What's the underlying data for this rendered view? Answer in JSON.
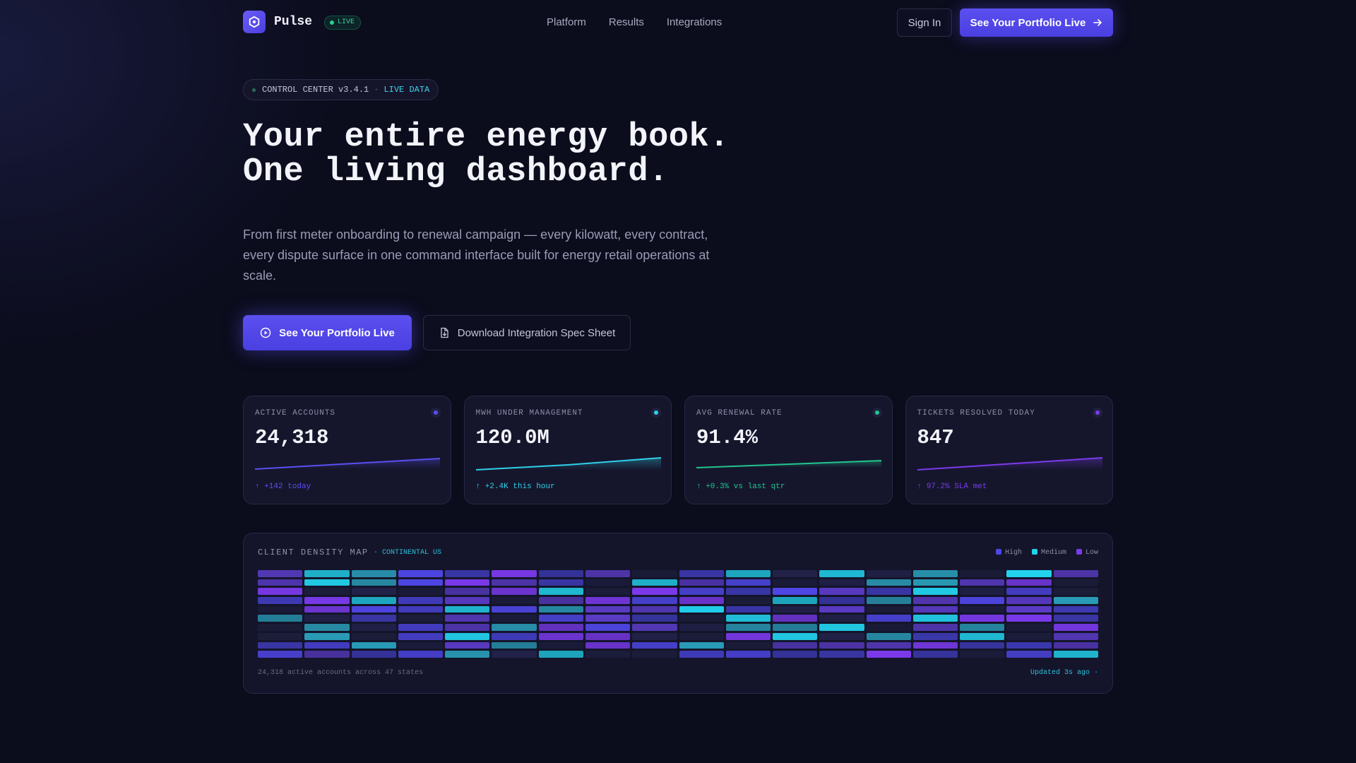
{
  "nav": {
    "brand": "Pulse",
    "live_badge": "LIVE",
    "links": [
      "Platform",
      "Results",
      "Integrations"
    ],
    "sign_in": "Sign In",
    "cta": "See Your Portfolio Live"
  },
  "hero": {
    "badge_version": "CONTROL CENTER v3.4.1",
    "badge_sep": "·",
    "badge_live": "LIVE DATA",
    "title_line1": "Your entire energy book.",
    "title_line2": "One living dashboard.",
    "lead": "From first meter onboarding to renewal campaign — every kilowatt, every contract, every dispute surface in one command interface built for energy retail operations at scale.",
    "primary_cta": "See Your Portfolio Live",
    "secondary_cta": "Download Integration Spec Sheet"
  },
  "metrics": [
    {
      "label": "ACTIVE ACCOUNTS",
      "value": "24,318",
      "delta": "↑ +142 today",
      "color": "#5b4ff0"
    },
    {
      "label": "MWH UNDER MANAGEMENT",
      "value": "120.0M",
      "delta": "↑ +2.4K this hour",
      "color": "#2fd0e8"
    },
    {
      "label": "AVG RENEWAL RATE",
      "value": "91.4%",
      "delta": "↑ +0.3% vs last qtr",
      "color": "#22c58e"
    },
    {
      "label": "TICKETS RESOLVED TODAY",
      "value": "847",
      "delta": "↑ 97.2% SLA met",
      "color": "#7c3aed"
    }
  ],
  "density_map": {
    "title": "CLIENT DENSITY MAP",
    "subtitle": "· CONTINENTAL US",
    "legend": [
      {
        "label": "High",
        "color": "#4f46e5"
      },
      {
        "label": "Medium",
        "color": "#22d3ee"
      },
      {
        "label": "Low",
        "color": "#7c3aed"
      }
    ],
    "footer_left": "24,318 active accounts across 47 states",
    "footer_right": "Updated 3s ago ·"
  }
}
